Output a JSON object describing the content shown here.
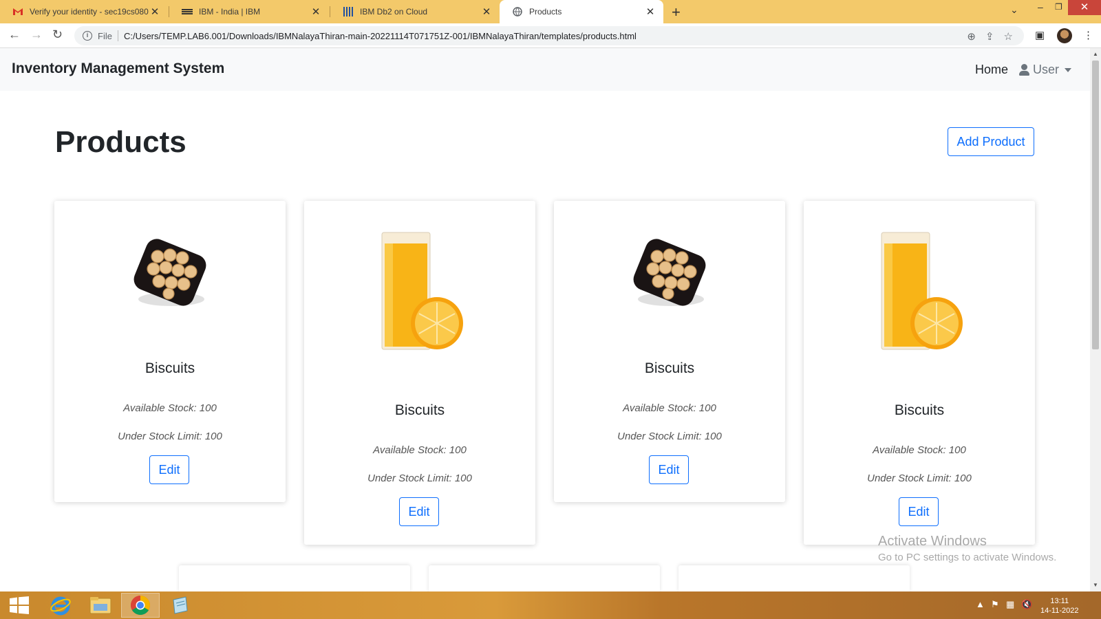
{
  "browser": {
    "tabs": [
      {
        "title": "Verify your identity - sec19cs080",
        "icon": "gmail-icon",
        "active": false
      },
      {
        "title": "IBM - India | IBM",
        "icon": "ibm-icon",
        "active": false
      },
      {
        "title": "IBM Db2 on Cloud",
        "icon": "db2-icon",
        "active": false
      },
      {
        "title": "Products",
        "icon": "globe-icon",
        "active": true
      }
    ],
    "scheme": "File",
    "url": "C:/Users/TEMP.LAB6.001/Downloads/IBMNalayaThiran-main-20221114T071751Z-001/IBMNalayaThiran/templates/products.html"
  },
  "navbar": {
    "brand": "Inventory Management System",
    "home": "Home",
    "user": "User"
  },
  "page": {
    "title": "Products",
    "add_button": "Add Product"
  },
  "products": [
    {
      "name": "Biscuits",
      "image": "biscuits",
      "stock": "Available Stock: 100",
      "limit": "Under Stock Limit: 100",
      "edit": "Edit"
    },
    {
      "name": "Biscuits",
      "image": "juice",
      "stock": "Available Stock: 100",
      "limit": "Under Stock Limit: 100",
      "edit": "Edit"
    },
    {
      "name": "Biscuits",
      "image": "biscuits",
      "stock": "Available Stock: 100",
      "limit": "Under Stock Limit: 100",
      "edit": "Edit"
    },
    {
      "name": "Biscuits",
      "image": "juice",
      "stock": "Available Stock: 100",
      "limit": "Under Stock Limit: 100",
      "edit": "Edit"
    }
  ],
  "watermark": {
    "line1": "Activate Windows",
    "line2": "Go to PC settings to activate Windows."
  },
  "taskbar": {
    "time": "13:11",
    "date": "14-11-2022"
  },
  "colors": {
    "tabstrip": "#f3c96a",
    "accent": "#0d6efd"
  }
}
